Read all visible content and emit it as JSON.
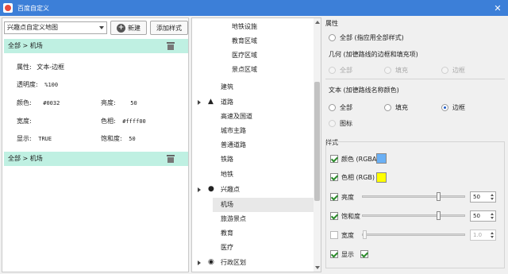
{
  "window": {
    "title": "百度自定义"
  },
  "left": {
    "selector_value": "兴趣点自定义地图",
    "new_button": "新建",
    "add_style_button": "添加样式",
    "style1": {
      "header": "全部 > 机场",
      "props": {
        "attr_label": "属性:",
        "attr_value": "文本-边框",
        "opacity_label": "透明度:",
        "opacity_value": "%100",
        "color_label": "颜色:",
        "color_value": "#0032",
        "lightness_label": "亮度:",
        "lightness_value": "50",
        "width_label": "宽度:",
        "width_value": "",
        "hue_label": "色相:",
        "hue_value": "#ffff00",
        "visible_label": "显示:",
        "visible_value": "TRUE",
        "saturation_label": "饱和度:",
        "saturation_value": "50"
      }
    },
    "style2": {
      "header": "全部 > 机场"
    }
  },
  "tree": {
    "items": [
      {
        "label": "地铁设施"
      },
      {
        "label": "教育区域"
      },
      {
        "label": "医疗区域"
      },
      {
        "label": "景点区域"
      },
      {
        "label": "建筑"
      },
      {
        "label": "道路"
      },
      {
        "label": "高速及国道"
      },
      {
        "label": "城市主路"
      },
      {
        "label": "普通道路"
      },
      {
        "label": "铁路"
      },
      {
        "label": "地铁"
      },
      {
        "label": "兴趣点"
      },
      {
        "label": "机场"
      },
      {
        "label": "旅游景点"
      },
      {
        "label": "教育"
      },
      {
        "label": "医疗"
      },
      {
        "label": "行政区划"
      }
    ]
  },
  "right": {
    "attr_title": "属性",
    "all_option": "全部 (指应用全部样式)",
    "geometry_title": "几何 (加德路线的边框和填充项)",
    "geometry_options": [
      "全部",
      "填充",
      "边框"
    ],
    "text_title": "文本 (加德路线名称颜色)",
    "text_options": [
      "全部",
      "填充",
      "边框"
    ],
    "icon_option": "图标",
    "style_title": "样式",
    "color_label": "颜色 (RGBA)",
    "hue_label": "色相 (RGB)",
    "lightness_label": "亮度",
    "lightness_value": "50",
    "saturation_label": "饱和度",
    "saturation_value": "50",
    "width_label": "宽度",
    "width_value": "1.0",
    "visible_label": "显示",
    "colors": {
      "color_swatch": "#6ab0f5",
      "hue_swatch": "#ffff00",
      "accent": "#3c7fd8",
      "selection": "#bff0e2"
    }
  }
}
